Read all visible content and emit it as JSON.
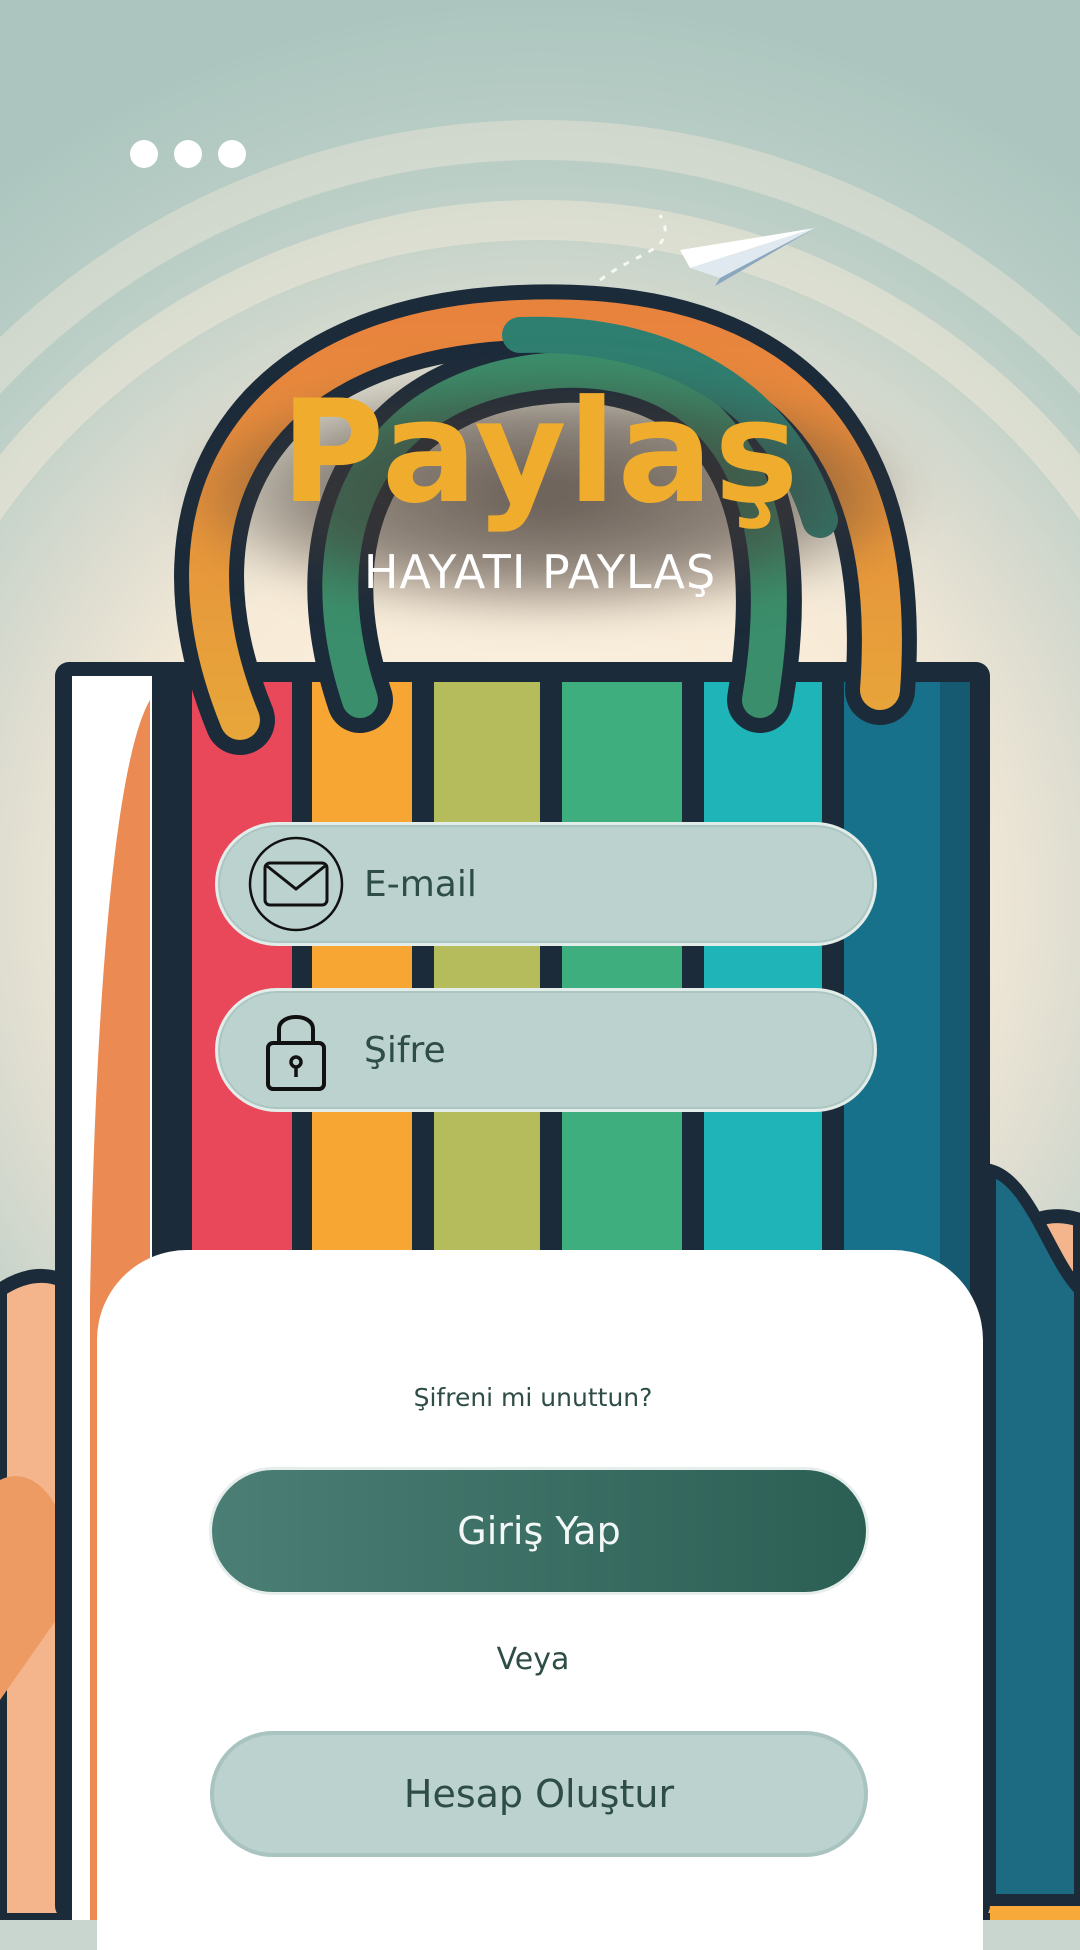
{
  "brand": {
    "title": "Paylaş",
    "tagline": "HAYATI PAYLAŞ"
  },
  "form": {
    "email_placeholder": "E-mail",
    "password_placeholder": "Şifre",
    "email_icon": "envelope-icon",
    "password_icon": "lock-icon"
  },
  "actions": {
    "forgot_password": "Şifreni mi unuttun?",
    "login_label": "Giriş Yap",
    "or_label": "Veya",
    "signup_label": "Hesap Oluştur"
  },
  "colors": {
    "brand_title": "#f0ad2d",
    "primary_button": "#3b6f64",
    "field_background": "#bcd2cf",
    "text_dark": "#2f4d47"
  }
}
